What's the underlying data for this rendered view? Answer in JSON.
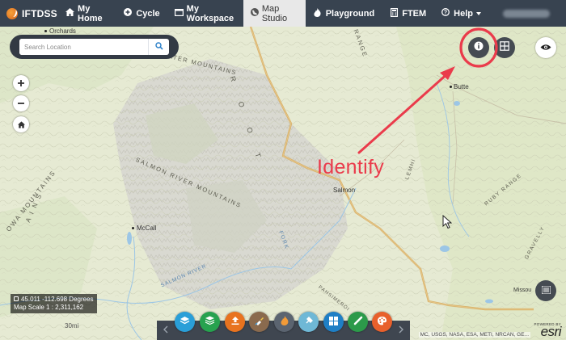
{
  "app": {
    "brand": "IFTDSS"
  },
  "nav": {
    "items": [
      {
        "label": "My Home",
        "icon": "home-icon"
      },
      {
        "label": "Cycle",
        "icon": "plus-circle-icon"
      },
      {
        "label": "My Workspace",
        "icon": "folder-icon"
      },
      {
        "label": "Map Studio",
        "icon": "globe-icon",
        "active": true
      },
      {
        "label": "Playground",
        "icon": "flame-icon"
      },
      {
        "label": "FTEM",
        "icon": "calculator-icon"
      }
    ],
    "help_label": "Help"
  },
  "search": {
    "placeholder": "Search Location"
  },
  "map": {
    "places": {
      "orchards": "Orchards",
      "butte": "Butte",
      "salmon": "Salmon",
      "mccall": "McCall",
      "missoula": "Missou"
    },
    "labels": {
      "clearwater": "CLEARWATER MOUNTAINS",
      "salmon_river_mtns": "SALMON RIVER MOUNTAINS",
      "salmon_river": "SALMON RIVER",
      "range": "RANGE",
      "ruby": "RUBY RANGE",
      "gravelly": "GRAVELLY",
      "pahsimeroi": "PAHSIMEROI",
      "ows_mountains": "OWA MOUNTAINS",
      "ains": "A I N S",
      "fork": "FORK",
      "bitterroot": "R O O T",
      "lemhi": "LEMHI"
    },
    "scale_label": "30mi"
  },
  "coords": {
    "position": "45.011 -112.698 Degrees",
    "scale": "Map Scale 1 : 2,311,162"
  },
  "attribution": "MC, USGS, NASA, ESA, METI, NRCAN, GE...",
  "esri": {
    "powered": "POWERED BY",
    "word": "esri"
  },
  "annotation": {
    "label": "Identify"
  },
  "colors": {
    "navbar": "#384350",
    "annotation": "#ea3b4b",
    "tool_blue": "#2a9fd8",
    "tool_green": "#27a24f",
    "tool_orange": "#e8731f",
    "tool_brown": "#8a6a4e",
    "tool_gray": "#5b6470",
    "tool_lightblue": "#6fb8d6",
    "tool_winblue": "#1f7fc5",
    "tool_green2": "#2c9a4a",
    "tool_coral": "#e8602c"
  }
}
